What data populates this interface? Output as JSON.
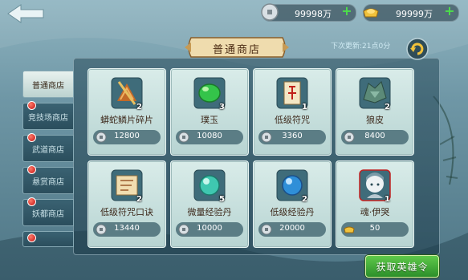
{
  "resources": {
    "silver": {
      "amount": "99998万",
      "icon": "silver-coin-icon"
    },
    "gold": {
      "amount": "99999万",
      "icon": "gold-ingot-icon"
    }
  },
  "shop": {
    "title": "普通商店",
    "refresh_text": "下次更新:21点0分"
  },
  "tabs": [
    {
      "label": "普通商店",
      "active": true,
      "badge": false
    },
    {
      "label": "竞技场商店",
      "active": false,
      "badge": true
    },
    {
      "label": "武道商店",
      "active": false,
      "badge": true
    },
    {
      "label": "悬赏商店",
      "active": false,
      "badge": true
    },
    {
      "label": "妖都商店",
      "active": false,
      "badge": true
    },
    {
      "label": "",
      "active": false,
      "badge": true
    }
  ],
  "items": [
    {
      "name": "蟒蛇鳞片碎片",
      "count": "2",
      "price": "12800",
      "currency": "silver",
      "icon": "scale-fragment-icon"
    },
    {
      "name": "璞玉",
      "count": "3",
      "price": "10080",
      "currency": "silver",
      "icon": "jade-icon"
    },
    {
      "name": "低级符咒",
      "count": "1",
      "price": "3360",
      "currency": "silver",
      "icon": "talisman-scroll-icon"
    },
    {
      "name": "狼皮",
      "count": "2",
      "price": "8400",
      "currency": "silver",
      "icon": "wolf-pelt-icon"
    },
    {
      "name": "低级符咒口诀",
      "count": "2",
      "price": "13440",
      "currency": "silver",
      "icon": "talisman-recipe-icon"
    },
    {
      "name": "微量经验丹",
      "count": "5",
      "price": "10000",
      "currency": "silver",
      "icon": "small-exp-pill-icon"
    },
    {
      "name": "低级经验丹",
      "count": "2",
      "price": "20000",
      "currency": "silver",
      "icon": "exp-pill-icon"
    },
    {
      "name": "魂·伊哭",
      "count": "1",
      "price": "50",
      "currency": "gold",
      "icon": "hero-soul-portrait-icon"
    }
  ],
  "bottom_button": {
    "label": "获取英雄令"
  },
  "colors": {
    "accent_green": "#3fae35",
    "badge_red": "#d01818",
    "card_bg": "#c8e0de"
  }
}
